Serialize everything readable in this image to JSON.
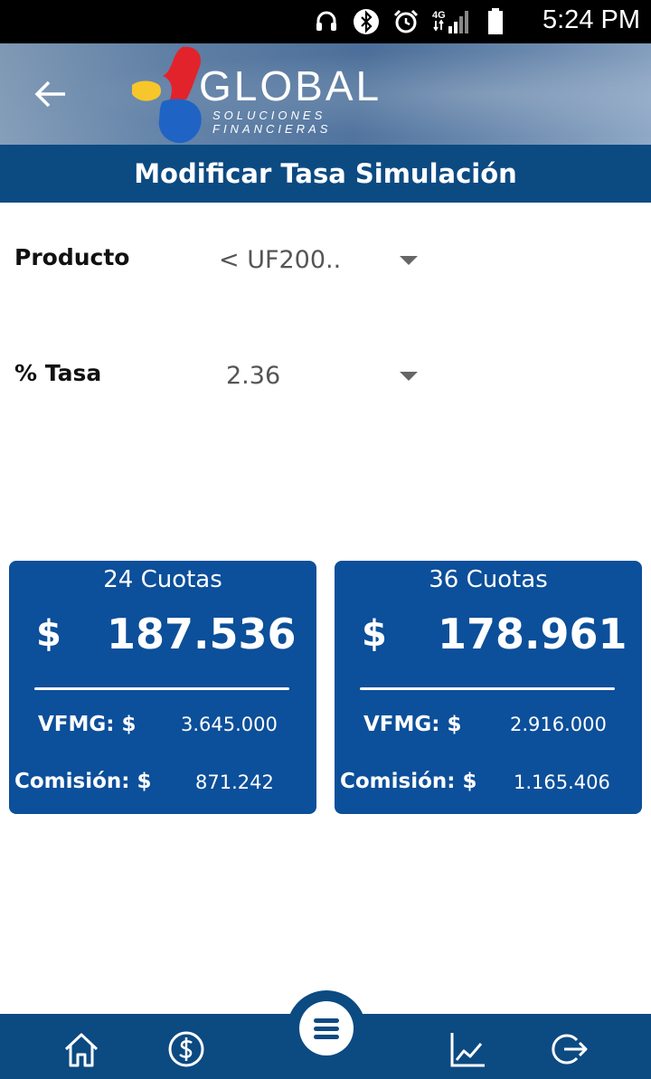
{
  "status_bar": {
    "time": "5:24 PM",
    "network": "4G",
    "icons": [
      "headset-icon",
      "bluetooth-icon",
      "alarm-icon",
      "signal-icon",
      "battery-icon"
    ]
  },
  "header": {
    "back_icon": "arrow-left-icon",
    "logo_word": "GLOBAL",
    "logo_subtitle": "SOLUCIONES FINANCIERAS",
    "title": "Modificar Tasa Simulación"
  },
  "form": {
    "product_label": "Producto",
    "product_value": "< UF200..",
    "rate_label": "% Tasa",
    "rate_value": "2.36"
  },
  "cards": [
    {
      "heading": "24 Cuotas",
      "currency": "$",
      "amount": "187.536",
      "vfmg_label": "VFMG: $",
      "vfmg_value": "3.645.000",
      "commission_label": "Comisión: $",
      "commission_value": "871.242"
    },
    {
      "heading": "36 Cuotas",
      "currency": "$",
      "amount": "178.961",
      "vfmg_label": "VFMG: $",
      "vfmg_value": "2.916.000",
      "commission_label": "Comisión: $",
      "commission_value": "1.165.406"
    }
  ],
  "bottom_nav": {
    "items": [
      "home-icon",
      "dollar-circle-icon",
      "menu-icon",
      "chart-line-icon",
      "logout-icon"
    ]
  },
  "colors": {
    "primary": "#0c4a82",
    "card": "#0c4f9a",
    "logo_red": "#e3232b",
    "logo_yellow": "#f7c62a",
    "logo_blue": "#1f63c5"
  }
}
